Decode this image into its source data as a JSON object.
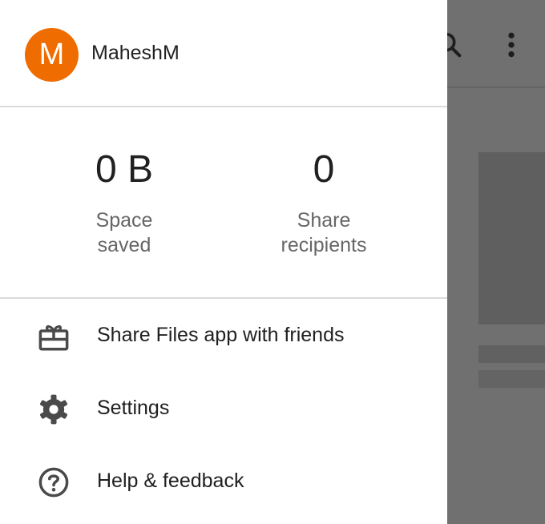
{
  "account": {
    "avatar_initial": "M",
    "username": "MaheshM",
    "avatar_color": "#ef6c00"
  },
  "stats": [
    {
      "value": "0 B",
      "label": "Space saved"
    },
    {
      "value": "0",
      "label": "Share recipients"
    }
  ],
  "menu": {
    "items": [
      {
        "label": "Share Files app with friends",
        "icon": "gift-icon"
      },
      {
        "label": "Settings",
        "icon": "gear-icon"
      },
      {
        "label": "Help & feedback",
        "icon": "help-icon"
      }
    ]
  },
  "background": {
    "icons": [
      "search-icon",
      "more-vert-icon"
    ]
  }
}
